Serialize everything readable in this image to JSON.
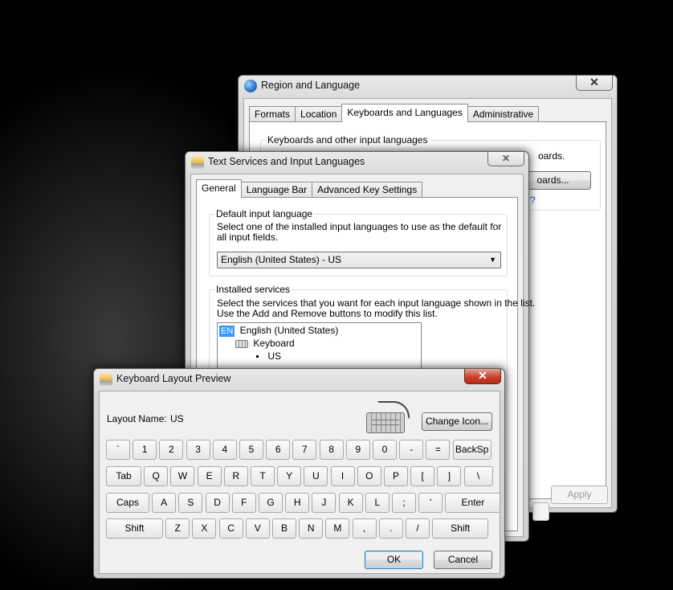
{
  "region_dialog": {
    "title": "Region and Language",
    "tabs": [
      "Formats",
      "Location",
      "Keyboards and Languages",
      "Administrative"
    ],
    "active_tab": 2,
    "group_label": "Keyboards and other input languages",
    "text_partial": "oards.",
    "change_button_partial": "oards...",
    "link_partial": "?",
    "apply_label": "Apply"
  },
  "text_services_dialog": {
    "title": "Text Services and Input Languages",
    "tabs": [
      "General",
      "Language Bar",
      "Advanced Key Settings"
    ],
    "active_tab": 0,
    "default_group_label": "Default input language",
    "default_desc": "Select one of the installed input languages to use as the default for all input fields.",
    "default_value": "English (United States) - US",
    "services_group_label": "Installed services",
    "services_desc_line1": "Select the services that you want for each input language shown in the list.",
    "services_desc_line2": "Use the Add and Remove buttons to modify this list.",
    "tree": {
      "lang_badge": "EN",
      "lang_name": "English (United States)",
      "keyboard_label": "Keyboard",
      "layout_item": "US"
    }
  },
  "preview_dialog": {
    "title": "Keyboard Layout Preview",
    "layout_name_label": "Layout Name:",
    "layout_name_value": "US",
    "change_icon_label": "Change Icon...",
    "ok_label": "OK",
    "cancel_label": "Cancel",
    "keyboard_rows": [
      [
        "`",
        "1",
        "2",
        "3",
        "4",
        "5",
        "6",
        "7",
        "8",
        "9",
        "0",
        "-",
        "=",
        "BackSp"
      ],
      [
        "Tab",
        "Q",
        "W",
        "E",
        "R",
        "T",
        "Y",
        "U",
        "I",
        "O",
        "P",
        "[",
        "]",
        "\\"
      ],
      [
        "Caps",
        "A",
        "S",
        "D",
        "F",
        "G",
        "H",
        "J",
        "K",
        "L",
        ";",
        "'",
        "Enter"
      ],
      [
        "Shift",
        "Z",
        "X",
        "C",
        "V",
        "B",
        "N",
        "M",
        ",",
        ".",
        "/",
        "Shift"
      ]
    ]
  },
  "colors": {
    "selection": "#3399ff",
    "close_red": "#c9412a"
  }
}
